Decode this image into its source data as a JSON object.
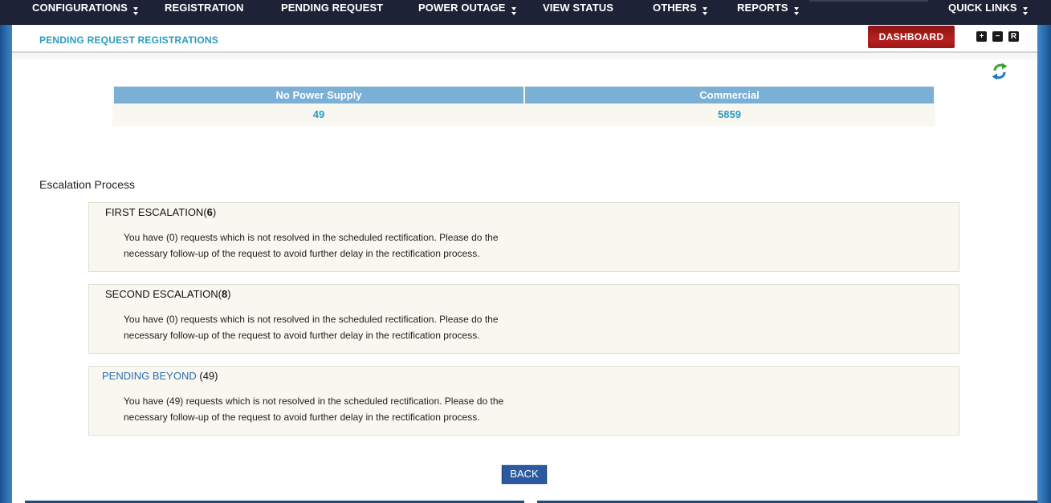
{
  "nav": {
    "configurations": "CONFIGURATIONS",
    "registration": "REGISTRATION",
    "pending_request": "PENDING REQUEST",
    "power_outage": "POWER OUTAGE",
    "view_status": "VIEW STATUS",
    "others": "OTHERS",
    "reports": "REPORTS",
    "quick_links": "QUICK LINKS"
  },
  "header": {
    "title": "PENDING REQUEST REGISTRATIONS",
    "dashboard": "DASHBOARD",
    "expand": "+",
    "collapse": "−",
    "reset": "R"
  },
  "summary": {
    "columns": [
      "No Power Supply",
      "Commercial"
    ],
    "values": [
      "49",
      "5859"
    ]
  },
  "escalation": {
    "heading": "Escalation Process",
    "first": {
      "label": "FIRST ESCALATION(",
      "count": "6",
      "close": ")",
      "message": "You have (0) requests which is not resolved in the scheduled rectification. Please do the necessary follow-up of the request to avoid further delay in the rectification process."
    },
    "second": {
      "label": "SECOND ESCALATION(",
      "count": "8",
      "close": ")",
      "message": "You have (0) requests which is not resolved in the scheduled rectification. Please do the necessary follow-up of the request to avoid further delay in the rectification process."
    },
    "beyond": {
      "label": "PENDING BEYOND",
      "count": " (49)",
      "message": "You have (49) requests which is not resolved in the scheduled rectification. Please do the necessary follow-up of the request to avoid further delay in the rectification process."
    }
  },
  "actions": {
    "back": "BACK"
  },
  "colors": {
    "nav_bg": "#1e2236",
    "title_blue": "#2a9bc0",
    "dashboard_red": "#b82020",
    "table_head": "#7aafd6",
    "back_button": "#2c5aa0"
  }
}
